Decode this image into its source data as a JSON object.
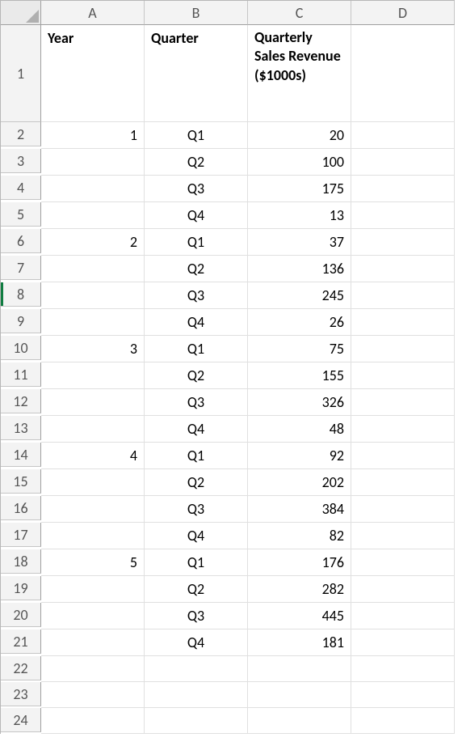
{
  "columns": [
    "A",
    "B",
    "C",
    "D"
  ],
  "row_count": 24,
  "selected_row_header": 8,
  "headers": {
    "A": "Year",
    "B": "Quarter",
    "C": "Quarterly Sales Revenue ($1000s)"
  },
  "rows": [
    {
      "A": "1",
      "B": "Q1",
      "C": "20"
    },
    {
      "A": "",
      "B": "Q2",
      "C": "100"
    },
    {
      "A": "",
      "B": "Q3",
      "C": "175"
    },
    {
      "A": "",
      "B": "Q4",
      "C": "13"
    },
    {
      "A": "2",
      "B": "Q1",
      "C": "37"
    },
    {
      "A": "",
      "B": "Q2",
      "C": "136"
    },
    {
      "A": "",
      "B": "Q3",
      "C": "245"
    },
    {
      "A": "",
      "B": "Q4",
      "C": "26"
    },
    {
      "A": "3",
      "B": "Q1",
      "C": "75"
    },
    {
      "A": "",
      "B": "Q2",
      "C": "155"
    },
    {
      "A": "",
      "B": "Q3",
      "C": "326"
    },
    {
      "A": "",
      "B": "Q4",
      "C": "48"
    },
    {
      "A": "4",
      "B": "Q1",
      "C": "92"
    },
    {
      "A": "",
      "B": "Q2",
      "C": "202"
    },
    {
      "A": "",
      "B": "Q3",
      "C": "384"
    },
    {
      "A": "",
      "B": "Q4",
      "C": "82"
    },
    {
      "A": "5",
      "B": "Q1",
      "C": "176"
    },
    {
      "A": "",
      "B": "Q2",
      "C": "282"
    },
    {
      "A": "",
      "B": "Q3",
      "C": "445"
    },
    {
      "A": "",
      "B": "Q4",
      "C": "181"
    }
  ]
}
